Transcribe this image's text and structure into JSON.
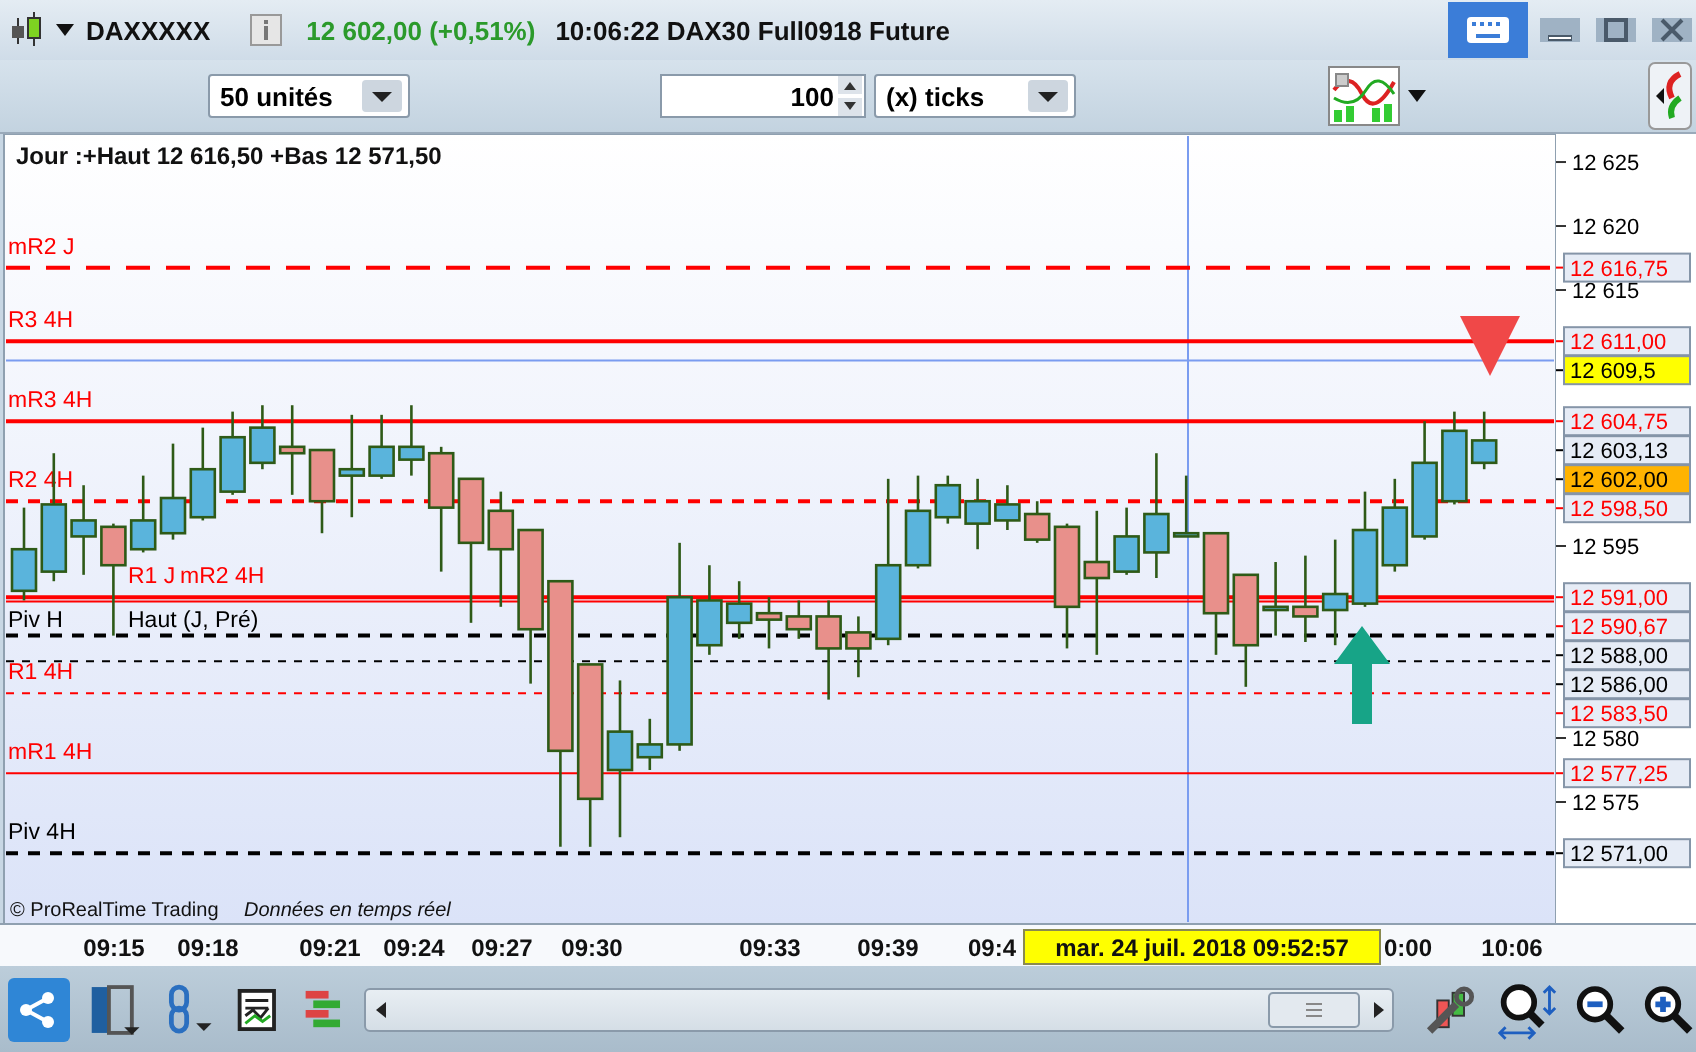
{
  "title_bar": {
    "symbol": "DAXXXXX",
    "price": "12 602,00 (+0,51%)",
    "description": "10:06:22 DAX30 Full0918 Future"
  },
  "toolbar": {
    "units_select": "50 unités",
    "ticks_value": "100",
    "ticks_select": "(x) ticks"
  },
  "chart": {
    "header": "Jour :+Haut 12 616,50 +Bas 12 571,50",
    "copyright": "© ProRealTime Trading",
    "data_note": "Données en temps réel",
    "axis": [
      {
        "kind": "tag",
        "text": "12 616,75",
        "color": "#ff0000"
      },
      {
        "kind": "tag",
        "text": "12 611,00",
        "color": "#ff0000"
      },
      {
        "kind": "cursor",
        "text": "12 609,5",
        "color": "#000000"
      },
      {
        "kind": "tag",
        "text": "12 604,75",
        "color": "#ff0000"
      },
      {
        "kind": "tag",
        "text": "12 603,13",
        "color": "#000000"
      },
      {
        "kind": "last",
        "text": "12 602,00",
        "color": "#000000"
      },
      {
        "kind": "tag",
        "text": "12 598,50",
        "color": "#ff0000"
      },
      {
        "kind": "tag",
        "text": "12 591,00",
        "color": "#ff0000"
      },
      {
        "kind": "tag",
        "text": "12 590,67",
        "color": "#ff0000"
      },
      {
        "kind": "tag",
        "text": "12 588,00",
        "color": "#000000"
      },
      {
        "kind": "tag",
        "text": "12 586,00",
        "color": "#000000"
      },
      {
        "kind": "tag",
        "text": "12 583,50",
        "color": "#ff0000"
      },
      {
        "kind": "tag",
        "text": "12 577,25",
        "color": "#ff0000"
      },
      {
        "kind": "tag",
        "text": "12 571,00",
        "color": "#000000"
      }
    ],
    "time_labels": [
      "09:15",
      "09:18",
      "09:21",
      "09:24",
      "09:27",
      "09:30",
      "09:33",
      "09:39",
      "09:4",
      "0:00",
      "10:06"
    ],
    "cursor_date": "mar. 24 juil. 2018 09:52:57",
    "chart_data": {
      "type": "candlestick",
      "ylim": [
        12565.47,
        12627.19
      ],
      "ref_lines": [
        {
          "axis": "y",
          "value": 12616.75,
          "label": "mR2 J",
          "color": "#ff0000"
        },
        {
          "axis": "y",
          "value": 12611,
          "label": "R3 4H",
          "color": "#ff0000"
        },
        {
          "axis": "y",
          "value": 12609.5,
          "color": "#7a9cf0"
        },
        {
          "axis": "y",
          "value": 12604.75,
          "label": "mR3 4H",
          "color": "#ff0000"
        },
        {
          "axis": "y",
          "value": 12598.5,
          "label": "R2 4H",
          "color": "#ff0000"
        },
        {
          "axis": "y",
          "value": 12591,
          "label": "R1 J",
          "color": "#ff0000"
        },
        {
          "axis": "y",
          "value": 12590.67,
          "label": "mR2 4H",
          "color": "#ff0000"
        },
        {
          "axis": "y",
          "value": 12588,
          "label": "Piv H",
          "color": "#000000"
        },
        {
          "axis": "y",
          "value": 12586,
          "label": "Haut (J, Pré)",
          "color": "#000000"
        },
        {
          "axis": "y",
          "value": 12583.5,
          "label": "R1 4H",
          "color": "#ff0000"
        },
        {
          "axis": "y",
          "value": 12577.25,
          "label": "mR1 4H",
          "color": "#ff0000"
        },
        {
          "axis": "y",
          "value": 12571,
          "label": "Piv 4H",
          "color": "#000000"
        }
      ],
      "categories": [
        null,
        null,
        null,
        null,
        null,
        null,
        null,
        null,
        null,
        null,
        null,
        null,
        null,
        null,
        null,
        null,
        null,
        null,
        null,
        null,
        null,
        null,
        null,
        null,
        null,
        null,
        null,
        null,
        null,
        null,
        null,
        null,
        null,
        null,
        null,
        null,
        null,
        null,
        null,
        null,
        null,
        null,
        null,
        null,
        null,
        null,
        null,
        null,
        null,
        null
      ],
      "yticks": [
        {
          "value": 12625,
          "label": "12 625"
        },
        {
          "value": 12620,
          "label": "12 620"
        },
        {
          "value": 12615,
          "label": "12 615"
        },
        {
          "value": 12595,
          "label": "12 595"
        },
        {
          "value": 12580,
          "label": "12 580"
        },
        {
          "value": 12575,
          "label": "12 575"
        }
      ],
      "ohlc": [
        [
          12591.5,
          12598,
          12590.75,
          12594.75
        ],
        [
          12593,
          12602.25,
          12592.25,
          12598.25
        ],
        [
          12595.75,
          12599.75,
          12592.75,
          12597
        ],
        [
          12596.5,
          12596.75,
          12588,
          12593.5
        ],
        [
          12594.75,
          12600.5,
          12594.5,
          12597
        ],
        [
          12596,
          12603,
          12595.5,
          12598.75
        ],
        [
          12597.25,
          12604.25,
          12597,
          12601
        ],
        [
          12599.25,
          12605.5,
          12599,
          12603.5
        ],
        [
          12601.5,
          12606,
          12601,
          12604.25
        ],
        [
          12602.75,
          12606,
          12599,
          12602.25
        ],
        [
          12602.5,
          12602.5,
          12596,
          12598.5
        ],
        [
          12600.5,
          12605.25,
          12597.25,
          12601
        ],
        [
          12600.5,
          12605.25,
          12600.25,
          12602.75
        ],
        [
          12601.75,
          12606,
          12600.5,
          12602.75
        ],
        [
          12602.25,
          12602.75,
          12593,
          12598
        ],
        [
          12600.25,
          12600.25,
          12589,
          12595.25
        ],
        [
          12597.75,
          12599.25,
          12590.25,
          12594.75
        ],
        [
          12596.25,
          12596.25,
          12584.25,
          12588.5
        ],
        [
          12592.25,
          12592.25,
          12571.5,
          12579
        ],
        [
          12585.75,
          12585.75,
          12571.5,
          12575.25
        ],
        [
          12577.5,
          12584.5,
          12572.25,
          12580.5
        ],
        [
          12578.5,
          12581.5,
          12577.5,
          12579.5
        ],
        [
          12579.5,
          12595.25,
          12579,
          12591
        ],
        [
          12587.25,
          12593.5,
          12586.5,
          12590.75
        ],
        [
          12589,
          12592.25,
          12587.75,
          12590.5
        ],
        [
          12589.75,
          12591,
          12587,
          12589.25
        ],
        [
          12589.5,
          12590.75,
          12587.75,
          12588.5
        ],
        [
          12589.5,
          12590.75,
          12583,
          12587
        ],
        [
          12588.25,
          12589.5,
          12584.75,
          12587
        ],
        [
          12587.75,
          12600.25,
          12587.25,
          12593.5
        ],
        [
          12593.5,
          12600.5,
          12593.25,
          12597.75
        ],
        [
          12597.25,
          12600.5,
          12596.75,
          12599.75
        ],
        [
          12596.75,
          12600.25,
          12594.75,
          12598.5
        ],
        [
          12597,
          12599.75,
          12596.25,
          12598.25
        ],
        [
          12597.5,
          12598.5,
          12595.25,
          12595.5
        ],
        [
          12596.5,
          12596.75,
          12587,
          12590.25
        ],
        [
          12593.75,
          12597.75,
          12586.5,
          12592.5
        ],
        [
          12593,
          12598,
          12592.75,
          12595.75
        ],
        [
          12594.5,
          12602.25,
          12592.5,
          12597.5
        ],
        [
          12595.75,
          12600.5,
          12595.75,
          12596
        ],
        [
          12596,
          12596,
          12586.5,
          12589.75
        ],
        [
          12592.75,
          12592.75,
          12584,
          12587.25
        ],
        [
          12590,
          12593.75,
          12588,
          12590.25
        ],
        [
          12590.25,
          12594.25,
          12587.5,
          12589.5
        ],
        [
          12590,
          12595.5,
          12587.25,
          12591.25
        ],
        [
          12590.5,
          12599.25,
          12590.25,
          12596.25
        ],
        [
          12593.5,
          12600.25,
          12593,
          12598
        ],
        [
          12595.75,
          12604.75,
          12595.5,
          12601.5
        ],
        [
          12598.5,
          12605.5,
          12598.25,
          12604
        ],
        [
          12601.5,
          12605.5,
          12601,
          12603.25
        ]
      ]
    }
  }
}
